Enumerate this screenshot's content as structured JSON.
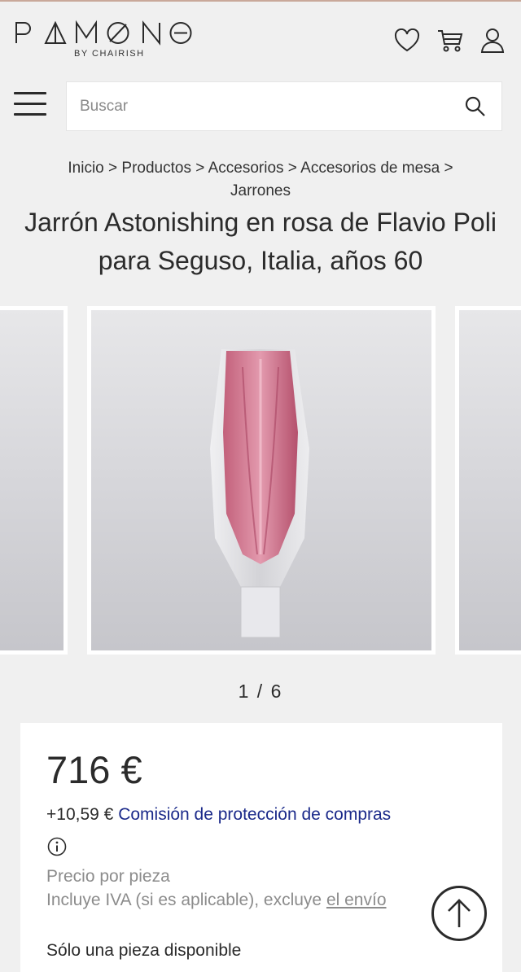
{
  "brand": {
    "logo_text": "PAMONO",
    "sub": "BY CHAIRISH"
  },
  "header": {
    "icons": [
      "heart-icon",
      "cart-icon",
      "user-icon"
    ]
  },
  "search": {
    "placeholder": "Buscar",
    "value": ""
  },
  "breadcrumb": {
    "items": [
      "Inicio",
      "Productos",
      "Accesorios",
      "Accesorios de mesa",
      "Jarrones"
    ],
    "separator": ">"
  },
  "product": {
    "title": "Jarrón Astonishing en rosa de Flavio Poli para Seguso, Italia, años 60",
    "image_counter": "1 / 6",
    "price": "716 €",
    "fee_amount": "+10,59 €",
    "fee_label": "Comisión de protección de compras",
    "per_piece": "Precio por pieza",
    "vat_text": "Incluye IVA (si es aplicable), excluye",
    "shipping_link": "el envío",
    "availability": "Sólo una pieza disponible"
  },
  "colors": {
    "link": "#1b2a8a",
    "background": "#f0f0f0",
    "muted": "#8c8c8c"
  }
}
